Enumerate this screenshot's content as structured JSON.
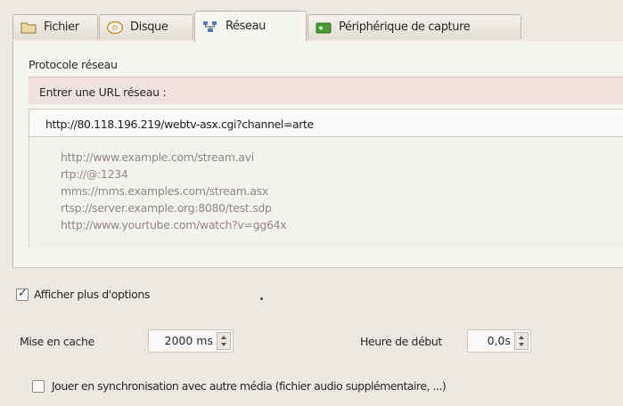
{
  "tabs": [
    {
      "label": "Fichier",
      "icon": "folder-icon"
    },
    {
      "label": "Disque",
      "icon": "disc-icon"
    },
    {
      "label": "Réseau",
      "icon": "network-icon"
    },
    {
      "label": "Périphérique de capture",
      "icon": "capture-device-icon"
    }
  ],
  "active_tab": "Réseau",
  "network": {
    "protocol_label": "Protocole réseau",
    "url_label": "Entrer une URL réseau :",
    "url_value": "http://80.118.196.219/webtv-asx.cgi?channel=arte",
    "examples": [
      "http://www.example.com/stream.avi",
      "rtp://@:1234",
      "mms://mms.examples.com/stream.asx",
      "rtsp://server.example.org:8080/test.sdp",
      "http://www.yourtube.com/watch?v=gg64x"
    ]
  },
  "options": {
    "show_more_label": "Afficher plus d'options",
    "show_more_checked": true,
    "cache_label": "Mise en cache",
    "cache_value": "2000 ms",
    "start_time_label": "Heure de début",
    "start_time_value": "0,0s",
    "sync_label": "Jouer en synchronisation avec autre média (fichier audio supplémentaire, ...)",
    "sync_checked": false
  },
  "colors": {
    "background": "#ece8e1",
    "url_label_highlight": "#efe2de",
    "example_text": "#8e8a84"
  }
}
